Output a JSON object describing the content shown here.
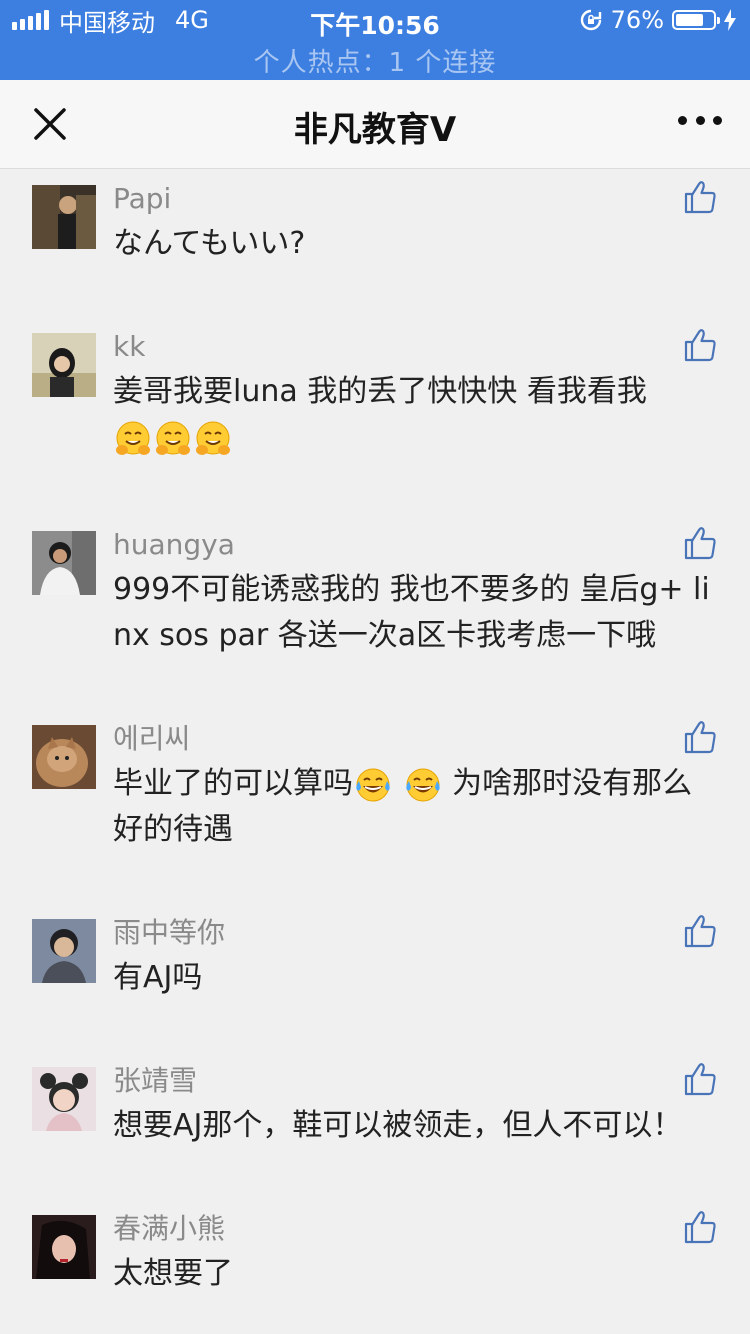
{
  "status_bar": {
    "carrier": "中国移动",
    "network": "4G",
    "time": "下午10:56",
    "battery_percent": "76%",
    "battery_level": 0.76,
    "hotspot": "个人热点：1 个连接"
  },
  "nav": {
    "title": "非凡教育V"
  },
  "colors": {
    "status_bar": "#3d7fe0",
    "like_icon": "#4a74b8",
    "name_text": "#8a8a8a"
  },
  "comments": [
    {
      "name": "Papi",
      "text": "なんてもいい?",
      "avatar_icon": "avatar-photo-icon"
    },
    {
      "name": "kk",
      "text": "姜哥我要luna 我的丢了快快快 看我看我",
      "emojis": [
        "hugging-face-icon",
        "hugging-face-icon",
        "hugging-face-icon"
      ]
    },
    {
      "name": "huangya",
      "text": "999不可能诱惑我的  我也不要多的 皇后g+ linx sos par 各送一次a区卡我考虑一下哦"
    },
    {
      "name": "에리씨",
      "text_before": "毕业了的可以算吗",
      "emojis": [
        "tears-of-joy-icon",
        "tears-of-joy-icon"
      ],
      "text_after": " 为啥那时没有那么好的待遇"
    },
    {
      "name": "雨中等你",
      "text": "有AJ吗"
    },
    {
      "name": "张靖雪",
      "text": "想要AJ那个，鞋可以被领走，但人不可以！"
    },
    {
      "name": "春满小熊",
      "text": "太想要了"
    }
  ]
}
